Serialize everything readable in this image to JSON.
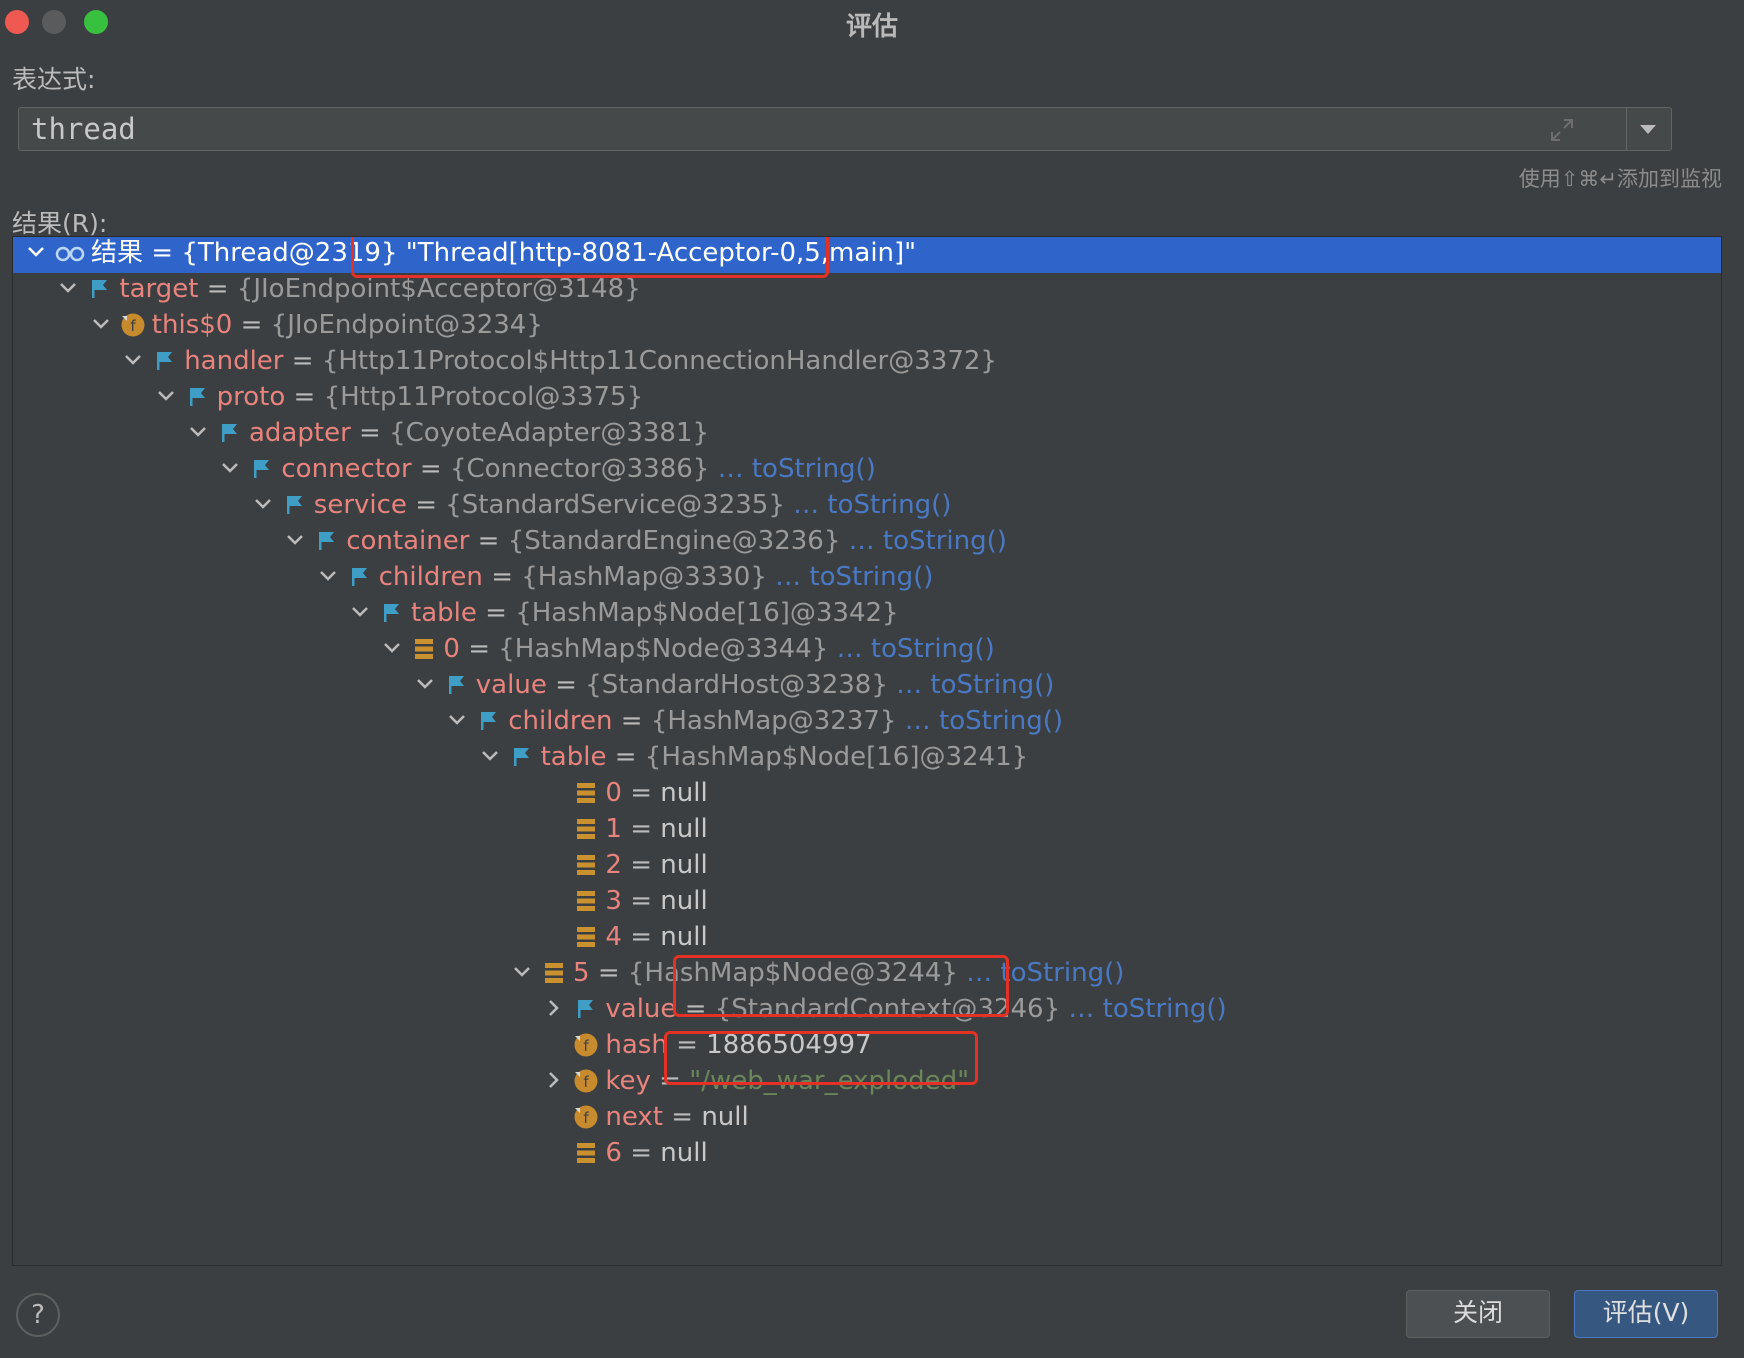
{
  "window": {
    "title": "评估"
  },
  "expression": {
    "label": "表达式:",
    "value": "thread",
    "hint": "使用⇧⌘↵添加到监视"
  },
  "result": {
    "label": "结果(R):"
  },
  "tree": [
    {
      "name": "结果",
      "eq": "=",
      "value": "{Thread@2319} \"Thread[http-8081-Acceptor-0,5,main]\"",
      "icon": "watch-glasses-icon",
      "chevron": "down",
      "selected": true
    },
    {
      "name": "target",
      "eq": "=",
      "value": "{JIoEndpoint$Acceptor@3148}",
      "icon": "field-flag-icon",
      "chevron": "down"
    },
    {
      "name": "this$0",
      "eq": "=",
      "value": "{JIoEndpoint@3234}",
      "icon": "final-field-icon",
      "chevron": "down"
    },
    {
      "name": "handler",
      "eq": "=",
      "value": "{Http11Protocol$Http11ConnectionHandler@3372}",
      "icon": "field-flag-icon",
      "chevron": "down"
    },
    {
      "name": "proto",
      "eq": "=",
      "value": "{Http11Protocol@3375}",
      "icon": "field-flag-icon",
      "chevron": "down"
    },
    {
      "name": "adapter",
      "eq": "=",
      "value": "{CoyoteAdapter@3381}",
      "icon": "field-flag-icon",
      "chevron": "down"
    },
    {
      "name": "connector",
      "eq": "=",
      "value": "{Connector@3386}",
      "tostring": "… toString()",
      "icon": "field-flag-icon",
      "chevron": "down"
    },
    {
      "name": "service",
      "eq": "=",
      "value": "{StandardService@3235}",
      "tostring": "… toString()",
      "icon": "field-flag-icon",
      "chevron": "down"
    },
    {
      "name": "container",
      "eq": "=",
      "value": "{StandardEngine@3236}",
      "tostring": "… toString()",
      "icon": "field-flag-icon",
      "chevron": "down"
    },
    {
      "name": "children",
      "eq": "=",
      "value": "{HashMap@3330}",
      "tostring": "… toString()",
      "icon": "field-flag-icon",
      "chevron": "down"
    },
    {
      "name": "table",
      "eq": "=",
      "value": "{HashMap$Node[16]@3342}",
      "icon": "field-flag-icon",
      "chevron": "down"
    },
    {
      "name": "0",
      "eq": "=",
      "value": "{HashMap$Node@3344}",
      "tostring": "… toString()",
      "icon": "array-element-icon",
      "chevron": "down"
    },
    {
      "name": "value",
      "eq": "=",
      "value": "{StandardHost@3238}",
      "tostring": "… toString()",
      "icon": "field-flag-icon",
      "chevron": "down"
    },
    {
      "name": "children",
      "eq": "=",
      "value": "{HashMap@3237}",
      "tostring": "… toString()",
      "icon": "field-flag-icon",
      "chevron": "down"
    },
    {
      "name": "table",
      "eq": "=",
      "value": "{HashMap$Node[16]@3241}",
      "icon": "field-flag-icon",
      "chevron": "down"
    },
    {
      "name": "0",
      "eq": "=",
      "value": "null",
      "icon": "array-element-icon",
      "chevron": "none"
    },
    {
      "name": "1",
      "eq": "=",
      "value": "null",
      "icon": "array-element-icon",
      "chevron": "none"
    },
    {
      "name": "2",
      "eq": "=",
      "value": "null",
      "icon": "array-element-icon",
      "chevron": "none"
    },
    {
      "name": "3",
      "eq": "=",
      "value": "null",
      "icon": "array-element-icon",
      "chevron": "none"
    },
    {
      "name": "4",
      "eq": "=",
      "value": "null",
      "icon": "array-element-icon",
      "chevron": "none"
    },
    {
      "name": "5",
      "eq": "=",
      "value": "{HashMap$Node@3244}",
      "tostring": "… toString()",
      "icon": "array-element-icon",
      "chevron": "down"
    },
    {
      "name": "value",
      "eq": "=",
      "value": "{StandardContext@3246}",
      "tostring": "… toString()",
      "icon": "field-flag-icon",
      "chevron": "right"
    },
    {
      "name": "hash",
      "eq": "=",
      "value": "1886504997",
      "icon": "final-field-icon",
      "chevron": "none"
    },
    {
      "name": "key",
      "eq": "=",
      "value": "\"/web_war_exploded\"",
      "icon": "final-field-icon",
      "chevron": "right"
    },
    {
      "name": "next",
      "eq": "=",
      "value": "null",
      "icon": "final-field-icon",
      "chevron": "none"
    },
    {
      "name": "6",
      "eq": "=",
      "value": "null",
      "icon": "array-element-icon",
      "chevron": "none"
    }
  ],
  "buttons": {
    "help": "?",
    "close": "关闭",
    "evaluate": "评估(V)"
  },
  "colors": {
    "selection": "#2f65ca",
    "field_name": "#e8837d",
    "value_gray": "#9a9a9a",
    "tostring_link": "#4a79c4",
    "string_value": "#6a8759",
    "annotation_box": "#e33125"
  }
}
